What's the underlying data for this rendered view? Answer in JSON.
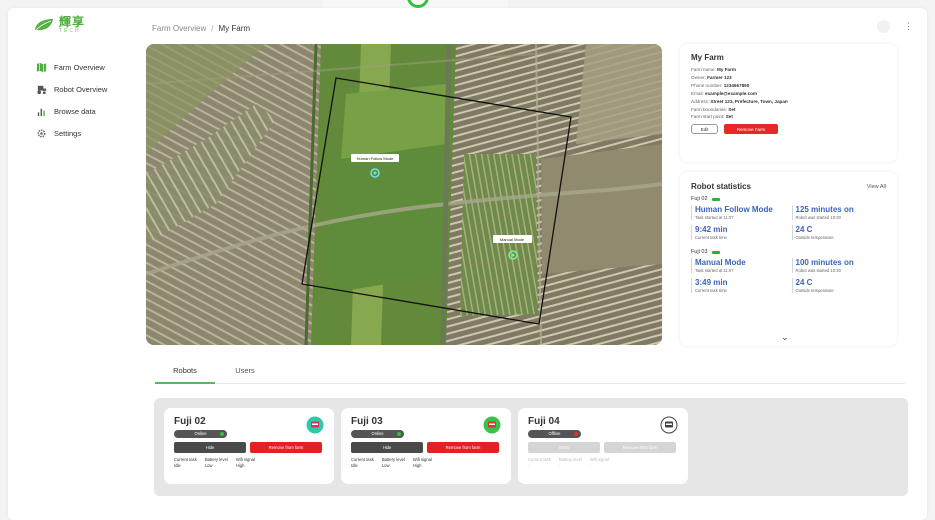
{
  "brand": {
    "name_cn": "輝享",
    "name_en": "TECH"
  },
  "colors": {
    "accent": "#4cae3f",
    "danger": "#e62828",
    "stat_blue": "#3a64b8"
  },
  "sidebar": {
    "items": [
      {
        "label": "Farm Overview",
        "icon": "map-icon"
      },
      {
        "label": "Robot Overview",
        "icon": "tractor-icon"
      },
      {
        "label": "Browse data",
        "icon": "bar-chart-icon"
      },
      {
        "label": "Settings",
        "icon": "gear-icon"
      }
    ]
  },
  "breadcrumb": {
    "parent": "Farm Overview",
    "separator": "/",
    "current": "My Farm"
  },
  "map": {
    "markers": [
      {
        "label": "Human Follow Mode"
      },
      {
        "label": "Manual Mode"
      }
    ]
  },
  "farm": {
    "title": "My Farm",
    "lines": [
      {
        "k": "Farm name:",
        "v": "My Farm"
      },
      {
        "k": "Owner:",
        "v": "Farmer 123"
      },
      {
        "k": "Phone number:",
        "v": "1234567890"
      },
      {
        "k": "Email:",
        "v": "example@example.com"
      },
      {
        "k": "Address:",
        "v": "Street 123, Prefecture, Town, Japan"
      },
      {
        "k": "Farm boundaries:",
        "v": "Set"
      },
      {
        "k": "Farm start point:",
        "v": "Set"
      }
    ],
    "edit_label": "Edit",
    "remove_label": "Remove Farm"
  },
  "stats": {
    "title": "Robot statistics",
    "view_all": "View All",
    "robots": [
      {
        "name": "Fuji 02",
        "mode": "Human Follow Mode",
        "mode_cap": "Task started at 11:07",
        "uptime": "125 minutes on",
        "uptime_cap": "Robot was started 10:30",
        "task_time": "9:42 min",
        "task_cap": "Current task time",
        "temp": "24 C",
        "temp_cap": "Outside temperature"
      },
      {
        "name": "Fuji 03",
        "mode": "Manual Mode",
        "mode_cap": "Task started at 11:07",
        "uptime": "100 minutes on",
        "uptime_cap": "Robot was started 10:30",
        "task_time": "3:49 min",
        "task_cap": "Current task time",
        "temp": "24 C",
        "temp_cap": "Outside temperature"
      }
    ]
  },
  "tabs": [
    {
      "label": "Robots"
    },
    {
      "label": "Users"
    }
  ],
  "robot_cards": [
    {
      "name": "Fuji 02",
      "status": "Online",
      "btn1": "Hide",
      "btn2": "Remove from farm",
      "meta_headers": [
        "Current task",
        "Battery level",
        "Wifi signal"
      ],
      "meta_values": [
        "Idle",
        "Low",
        "High"
      ]
    },
    {
      "name": "Fuji 03",
      "status": "Online",
      "btn1": "Hide",
      "btn2": "Remove from farm",
      "meta_headers": [
        "Current task",
        "Battery level",
        "Wifi signal"
      ],
      "meta_values": [
        "Idle",
        "Low",
        "High"
      ]
    },
    {
      "name": "Fuji 04",
      "status": "Offline",
      "btn1": "Show",
      "btn2": "Remove from farm",
      "meta_headers": [
        "Current task",
        "Battery level",
        "Wifi signal"
      ],
      "meta_values": [
        "-",
        "-",
        "-"
      ]
    }
  ]
}
